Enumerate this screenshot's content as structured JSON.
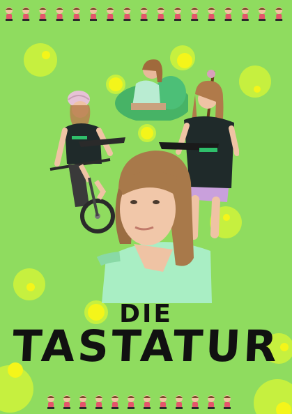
{
  "poster": {
    "title_line1": "DIE",
    "title_line2": "TASTATUR"
  },
  "colors": {
    "background": "#8fdc5f",
    "dot_outer": "#c6f03f",
    "dot_inner": "#f4f51a",
    "title": "#111111"
  }
}
